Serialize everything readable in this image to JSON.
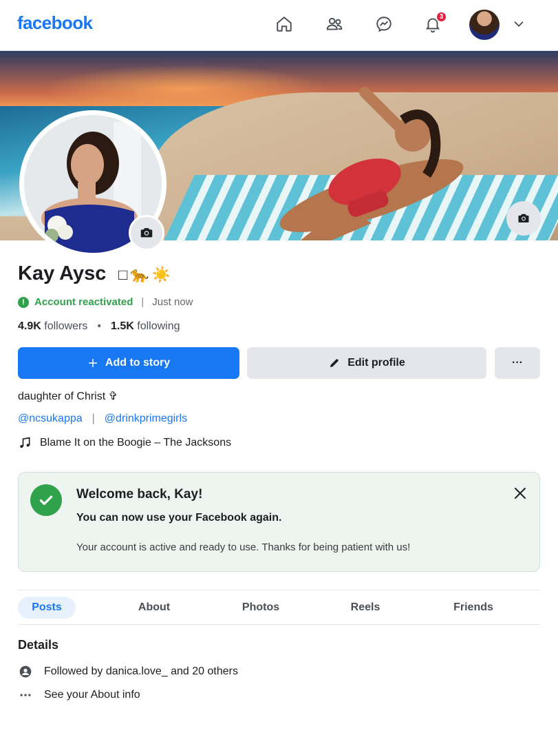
{
  "topbar": {
    "logo": "facebook",
    "notification_count": "3",
    "icons": [
      "home-icon",
      "friends-icon",
      "messenger-icon",
      "bell-icon",
      "chevron-down-icon"
    ]
  },
  "profile": {
    "name": "Kay Aysc",
    "name_emoji": [
      "□",
      "🐆",
      "☀️"
    ],
    "status": "Account reactivated",
    "status_time": "Just now",
    "followers_count": "4.9K",
    "followers_label": "followers",
    "following_count": "1.5K",
    "following_label": "following"
  },
  "actions": {
    "add_story": "Add to story",
    "edit_profile": "Edit profile",
    "more": "···"
  },
  "bio": {
    "text": "daughter of Christ ✞",
    "links": [
      "@ncsukappa",
      "@drinkprimegirls"
    ],
    "music": "Blame It on the Boogie – The Jacksons"
  },
  "welcome": {
    "title": "Welcome back, Kay!",
    "subtitle": "You can now use your Facebook again.",
    "body": "Your account is active and ready to use. Thanks for being patient with us!"
  },
  "tabs": [
    "Posts",
    "About",
    "Photos",
    "Reels",
    "Friends"
  ],
  "details": {
    "title": "Details",
    "followed_by": "Followed by danica.love_ and 20 others",
    "about": "See your About info"
  },
  "colors": {
    "brand": "#1877f2",
    "success": "#31a24c",
    "notification": "#e41e3f"
  }
}
